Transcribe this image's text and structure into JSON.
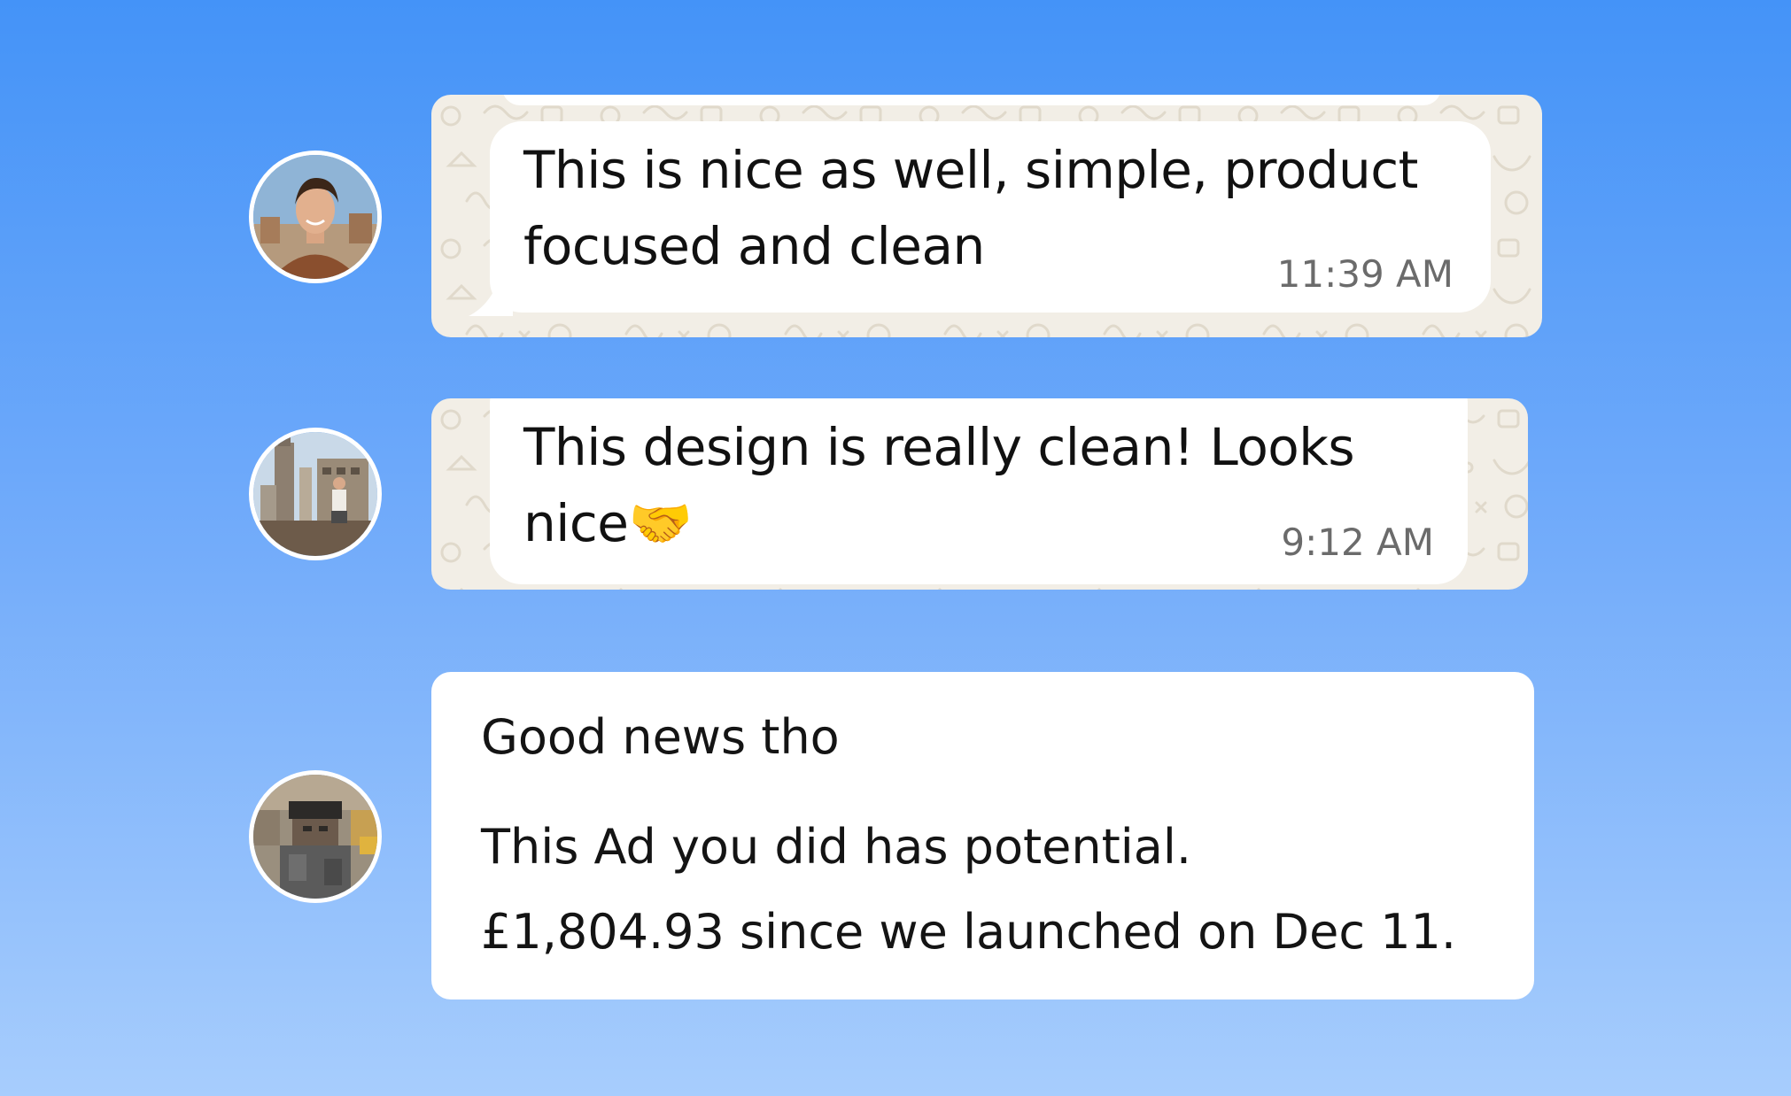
{
  "colors": {
    "background_top": "#4493f8",
    "background_bottom": "#a7cdfd",
    "whatsapp_wallpaper": "#f2eee6",
    "bubble": "#ffffff",
    "timestamp": "#6b6b6b"
  },
  "messages": [
    {
      "text_line1": "This is nice as well, simple, product",
      "text_line2": "focused and clean",
      "time": "11:39 AM",
      "avatar_icon": "avatar-young-man-portrait-icon"
    },
    {
      "text_line1": "This design is really clean! Looks",
      "text_line2": "nice",
      "emoji": "🤝",
      "time": "9:12 AM",
      "avatar_icon": "avatar-city-rooftop-icon"
    },
    {
      "line1": "Good news tho",
      "line2": "This Ad you did has potential.",
      "line3": "£1,804.93 since we launched on Dec 11.",
      "avatar_icon": "avatar-pixelated-person-icon"
    }
  ]
}
